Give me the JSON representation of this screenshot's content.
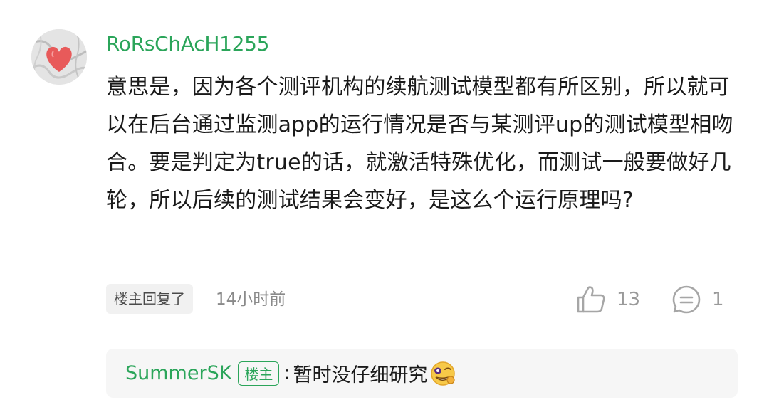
{
  "comment": {
    "username": "RoRsChAcH1255",
    "avatar_icon": "heart-avatar-icon",
    "text": "意思是，因为各个测评机构的续航测试模型都有所区别，所以就可以在后台通过监测app的运行情况是否与某测评up的测试模型相吻合。要是判定为true的话，就激活特殊优化，而测试一般要做好几轮，所以后续的测试结果会变好，是这么个运行原理吗?",
    "reply_badge": "楼主回复了",
    "timestamp": "14小时前",
    "like_icon": "thumbs-up-icon",
    "like_count": "13",
    "comment_icon": "comment-bubble-icon",
    "comment_count": "1"
  },
  "reply": {
    "username": "SummerSK",
    "op_badge": "楼主",
    "colon": ":",
    "text": "暂时没仔细研究",
    "emoji_icon": "sneaky-grin-emoji-icon"
  },
  "colors": {
    "username_green": "#2ba55a",
    "text": "#1a1a1a",
    "muted": "#8a8a8a",
    "reply_bg": "#f6f6f6"
  }
}
